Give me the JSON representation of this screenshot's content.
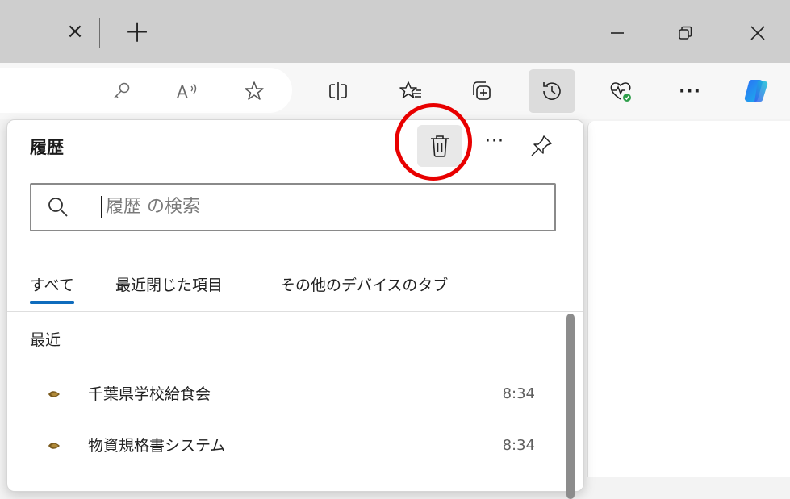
{
  "window": {
    "tab_close_glyph": "×",
    "new_tab_glyph": "+"
  },
  "toolbar": {
    "icons": [
      "key-icon",
      "read-aloud-icon",
      "star-icon",
      "split-screen-icon",
      "favorites-icon",
      "collections-icon",
      "history-icon",
      "browser-essentials-icon",
      "more-icon",
      "copilot-icon"
    ],
    "more_glyph": "···"
  },
  "history_panel": {
    "title": "履歴",
    "more_glyph": "···",
    "search": {
      "placeholder": "履歴 の検索"
    },
    "tabs": [
      {
        "label": "すべて",
        "active": true
      },
      {
        "label": "最近閉じた項目",
        "active": false
      },
      {
        "label": "その他のデバイスのタブ",
        "active": false
      }
    ],
    "section_heading": "最近",
    "items": [
      {
        "title": "千葉県学校給食会",
        "time": "8:34"
      },
      {
        "title": "物資規格書システム",
        "time": "8:34"
      }
    ]
  },
  "colors": {
    "accent": "#0f6cbd",
    "annotation": "#e80000"
  }
}
